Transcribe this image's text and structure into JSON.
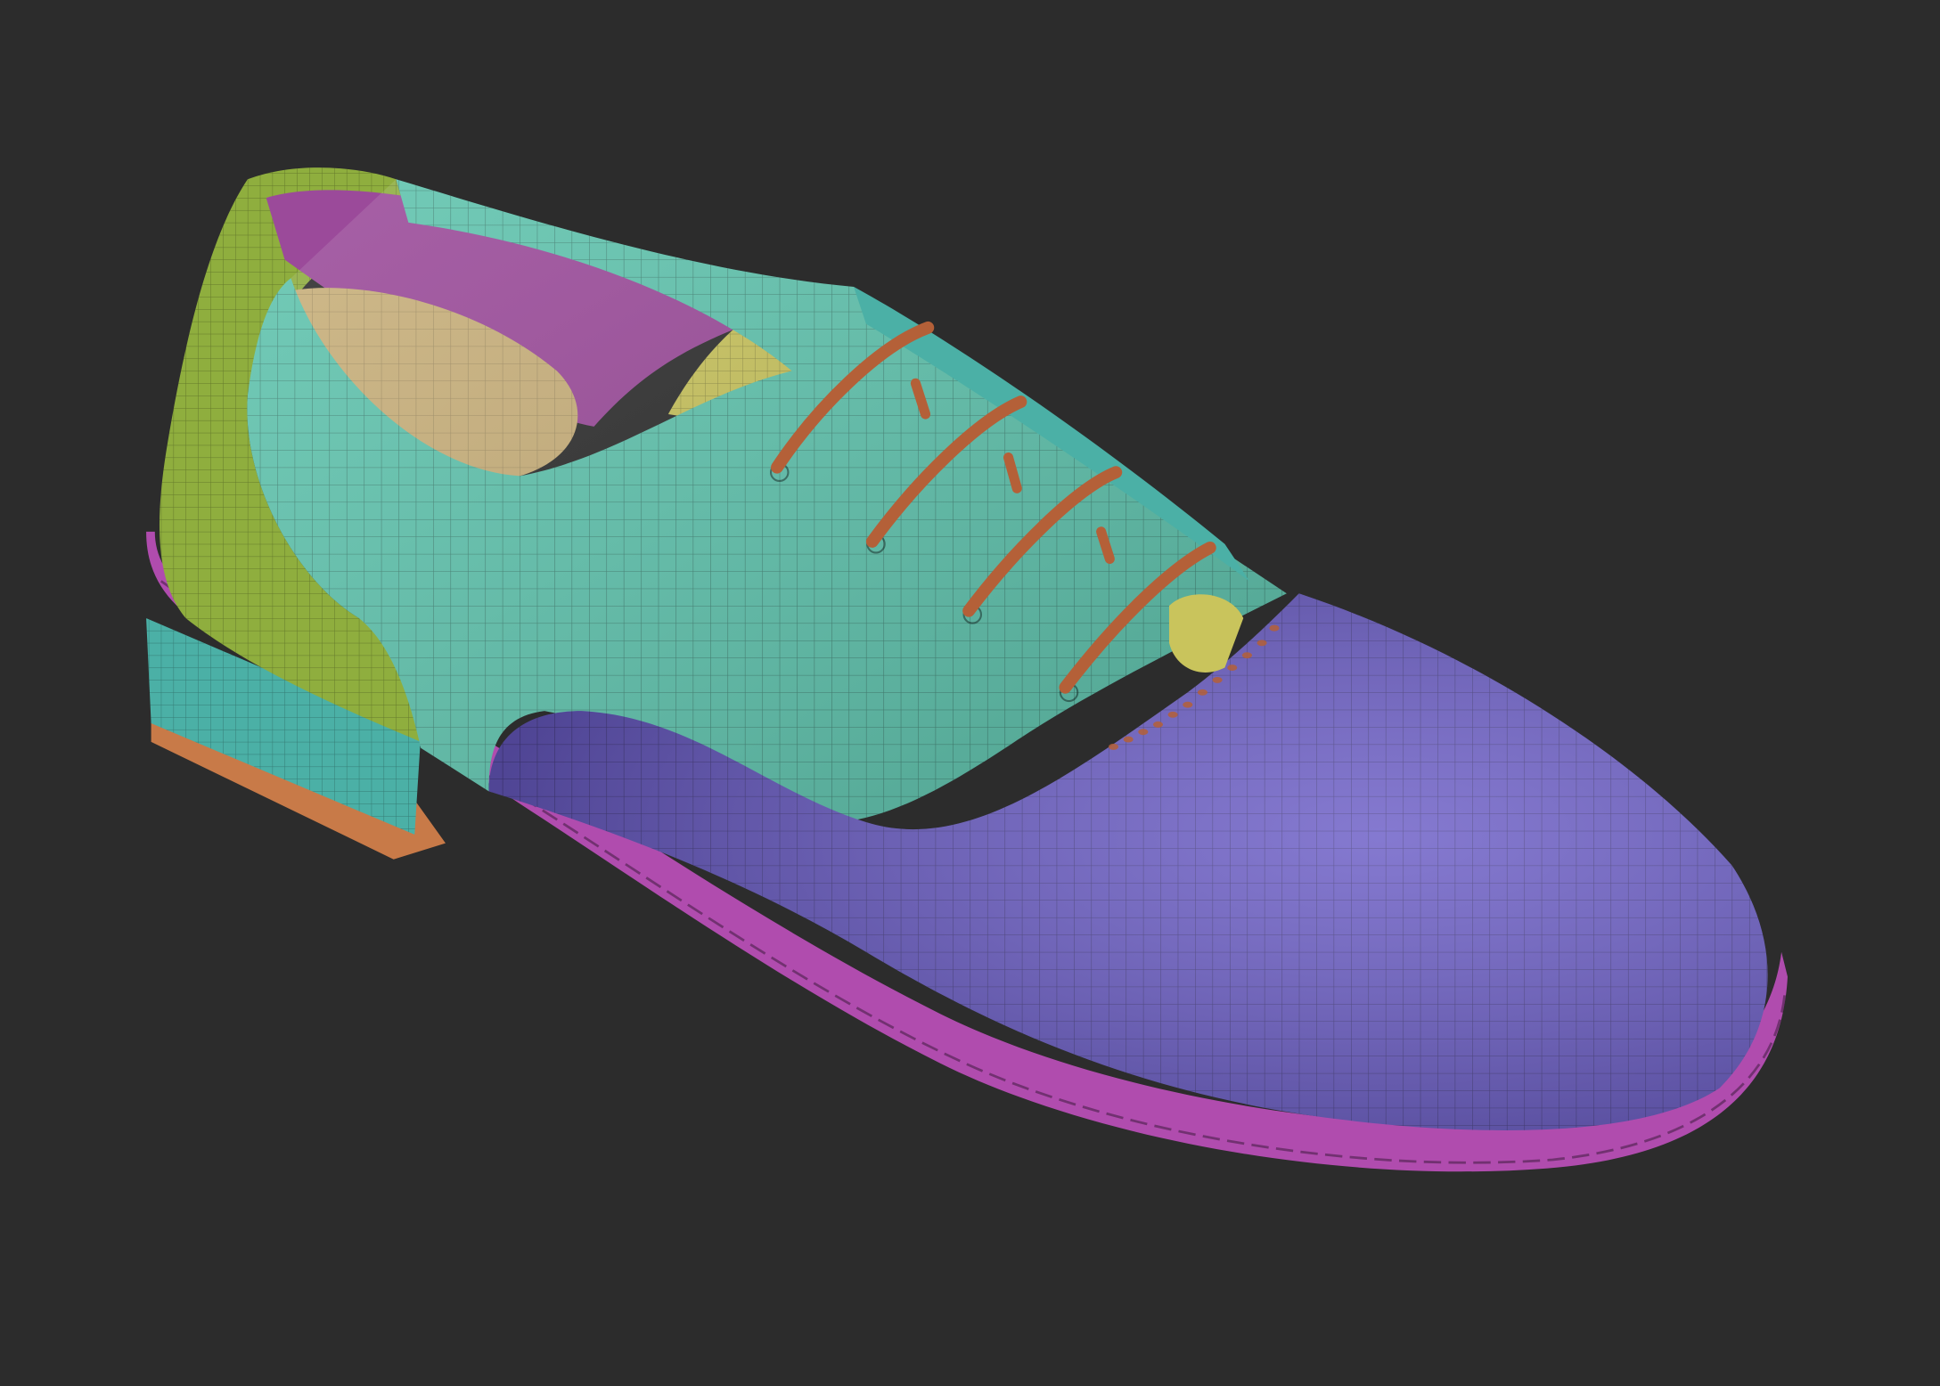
{
  "scene": {
    "subject": "shoe-model",
    "background_color": "#2c2c2c",
    "material_colors": {
      "toe_cap": "#6a5cc6",
      "vamp": "#5fc4ae",
      "heel_counter": "#8fae3e",
      "lining": "#9b4a9a",
      "tongue": "#c9c45c",
      "insole": "#c9b07a",
      "welt": "#b04cae",
      "laces": "#b46038",
      "heel_block": "#4bb0a6",
      "heel_base": "#c87a48"
    }
  }
}
